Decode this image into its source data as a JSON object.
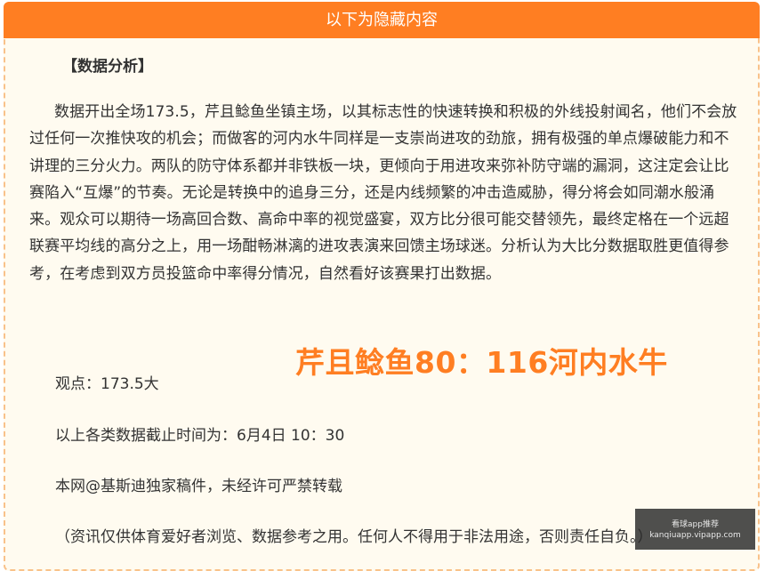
{
  "header": {
    "title": "以下为隐藏内容"
  },
  "article": {
    "section_title": "【数据分析】",
    "analysis_paragraph": "数据开出全场173.5，芹且鲶鱼坐镇主场，以其标志性的快速转换和积极的外线投射闻名，他们不会放过任何一次推快攻的机会；而做客的河内水牛同样是一支崇尚进攻的劲旅，拥有极强的单点爆破能力和不讲理的三分火力。两队的防守体系都并非铁板一块，更倾向于用进攻来弥补防守端的漏洞，这注定会让比赛陷入“互爆”的节奏。无论是转换中的追身三分，还是内线频繁的冲击造威胁，得分将会如同潮水般涌来。观众可以期待一场高回合数、高命中率的视觉盛宴，双方比分很可能交替领先，最终定格在一个远超联赛平均线的高分之上，用一场酣畅淋漓的进攻表演来回馈主场球迷。分析认为大比分数据取胜更值得参考，在考虑到双方员投篮命中率得分情况，自然看好该赛果打出数据。",
    "viewpoint": "观点：173.5大",
    "deadline": "以上各类数据截止时间为：6月4日 10：30",
    "copyright": "本网@基斯迪独家稿件，未经许可严禁转载",
    "disclaimer": "（资讯仅供体育爱好者浏览、数据参考之用。任何人不得用于非法用途，否则责任自负。）"
  },
  "score_overlay": {
    "text": "芹且鲶鱼80：116河内水牛"
  },
  "watermark": {
    "line1": "看球app推荐",
    "line2": "kanqiuapp.vipapp.com"
  },
  "colors": {
    "accent": "#ff7e22",
    "panel_bg": "#fffbf0",
    "border": "#f9c28a",
    "text": "#333333"
  }
}
